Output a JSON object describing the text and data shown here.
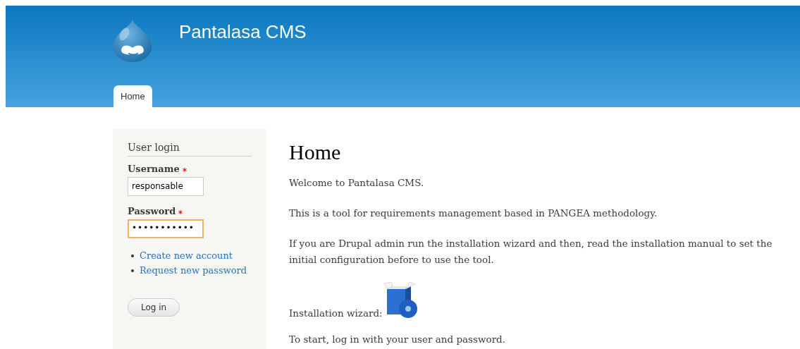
{
  "site": {
    "name": "Pantalasa CMS"
  },
  "tabs": [
    {
      "label": "Home",
      "selected": true
    }
  ],
  "login": {
    "title": "User login",
    "fields": [
      {
        "label": "Username",
        "required": true,
        "value": "responsable",
        "focused": false
      },
      {
        "label": "Password",
        "required": true,
        "value": "•••••••••••",
        "focused": true
      }
    ],
    "links": [
      "Create new account",
      "Request new password"
    ],
    "button": "Log in"
  },
  "main": {
    "title": "Home",
    "paragraphs": [
      "Welcome to Pantalasa CMS.",
      "This is a tool for requirements management based in PANGEA methodology.",
      "If you are Drupal admin run the installation wizard and then, read the installation manual to set the initial configuration before to use the tool."
    ],
    "wizard_label": "Installation wizard:",
    "closing": "To start, log in with your user and password."
  }
}
